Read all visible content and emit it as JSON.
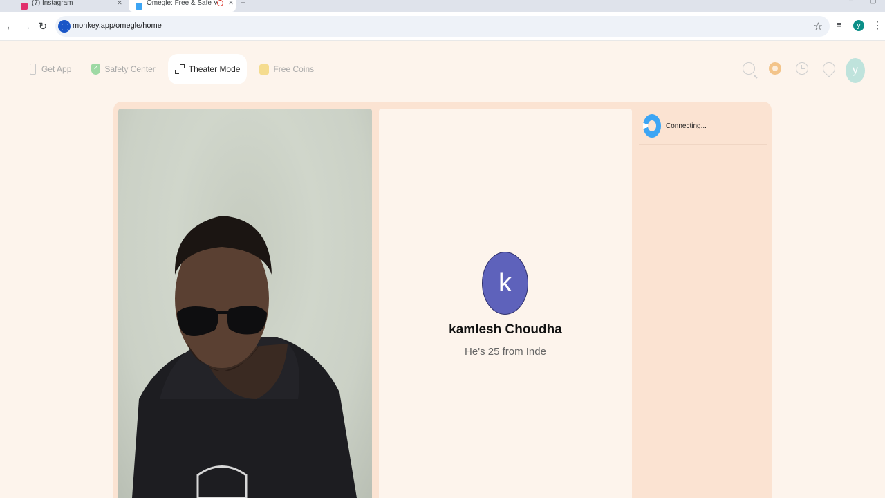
{
  "browser": {
    "tabs": [
      {
        "title": "(7) Instagram",
        "favicon_color": "#e1306c",
        "active": false
      },
      {
        "title": "Omegle: Free & Safe Vi",
        "favicon_color": "#3da5f4",
        "active": true
      }
    ],
    "new_tab_glyph": "+",
    "url": "monkey.app/omegle/home",
    "profile_initial": "y",
    "icons": [
      "back-arrow-icon",
      "forward-arrow-icon",
      "reload-icon",
      "star-icon",
      "media-controls-icon",
      "kebab-menu-icon"
    ]
  },
  "nav": {
    "items": [
      {
        "label": "Get App",
        "icon": "phone-icon",
        "active": false
      },
      {
        "label": "Safety Center",
        "icon": "shield-icon",
        "active": false
      },
      {
        "label": "Theater Mode",
        "icon": "expand-icon",
        "active": true
      },
      {
        "label": "Free Coins",
        "icon": "coins-icon",
        "active": false
      }
    ],
    "right_icons": [
      "search-icon",
      "coin-icon",
      "history-icon",
      "location-icon"
    ],
    "avatar_initial": "y"
  },
  "remote": {
    "initial": "k",
    "name": "kamlesh Choudha",
    "subtitle": "He's 25 from Inde",
    "avatar_color": "#5e62bb"
  },
  "side": {
    "status": "Connecting..."
  },
  "colors": {
    "page_bg": "#fdf4ec",
    "stage_bg": "#fbe3d2",
    "accent_blue": "#3da5f4"
  }
}
